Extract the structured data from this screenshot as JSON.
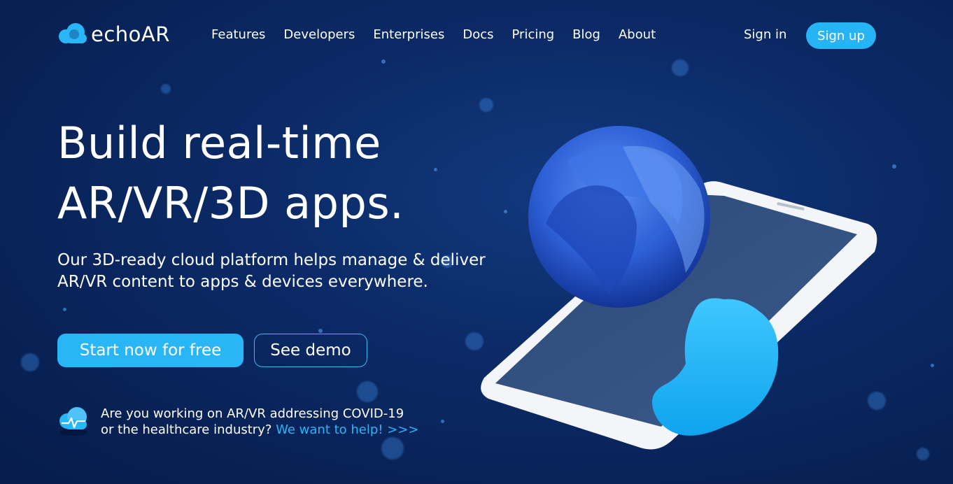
{
  "brand": {
    "name": "echoAR",
    "logo_icon": "cloud-icon"
  },
  "nav": {
    "links": [
      "Features",
      "Developers",
      "Enterprises",
      "Docs",
      "Pricing",
      "Blog",
      "About"
    ],
    "sign_in": "Sign in",
    "sign_up": "Sign up"
  },
  "hero": {
    "headline_line1": "Build real-time",
    "headline_line2": "AR/VR/3D apps.",
    "subhead_line1": "Our 3D-ready cloud platform helps manage & deliver",
    "subhead_line2": "AR/VR content to apps & devices everywhere.",
    "cta_primary": "Start now for free",
    "cta_secondary": "See demo"
  },
  "covid_banner": {
    "icon": "heartbeat-cloud-icon",
    "line1": "Are you working on AR/VR addressing COVID-19",
    "line2_prefix": "or the healthcare industry? ",
    "link_text": "We want to help! >>>"
  },
  "colors": {
    "accent": "#29b6f6",
    "background": "#0b2a66",
    "text": "#ffffff"
  }
}
